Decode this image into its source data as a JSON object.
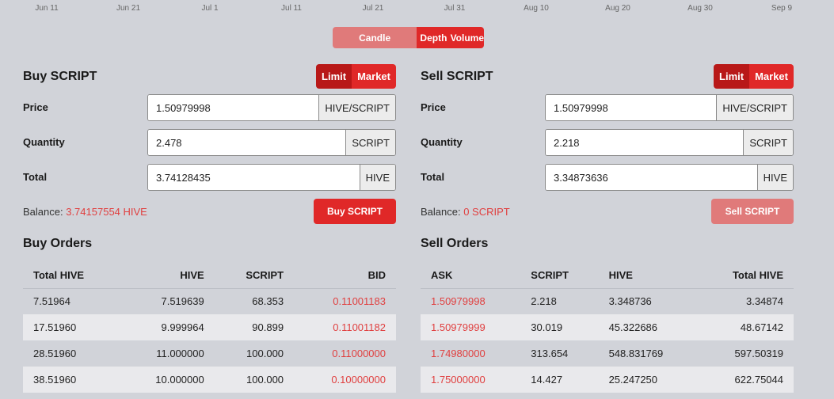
{
  "chart_axis": [
    "Jun 11",
    "Jun 21",
    "Jul 1",
    "Jul 11",
    "Jul 21",
    "Jul 31",
    "Aug 10",
    "Aug 20",
    "Aug 30",
    "Sep 9"
  ],
  "chart_tabs": [
    "Candle",
    "Depth",
    "Volume"
  ],
  "chart_tab_active": "Candle",
  "buy": {
    "title": "Buy SCRIPT",
    "modes": [
      "Limit",
      "Market"
    ],
    "mode_active": "Limit",
    "price_label": "Price",
    "price_value": "1.50979998",
    "price_unit": "HIVE/SCRIPT",
    "quantity_label": "Quantity",
    "quantity_value": "2.478",
    "quantity_unit": "SCRIPT",
    "total_label": "Total",
    "total_value": "3.74128435",
    "total_unit": "HIVE",
    "balance_label": "Balance:",
    "balance_value": "3.74157554 HIVE",
    "button_label": "Buy SCRIPT"
  },
  "sell": {
    "title": "Sell SCRIPT",
    "modes": [
      "Limit",
      "Market"
    ],
    "mode_active": "Limit",
    "price_label": "Price",
    "price_value": "1.50979998",
    "price_unit": "HIVE/SCRIPT",
    "quantity_label": "Quantity",
    "quantity_value": "2.218",
    "quantity_unit": "SCRIPT",
    "total_label": "Total",
    "total_value": "3.34873636",
    "total_unit": "HIVE",
    "balance_label": "Balance:",
    "balance_value": "0 SCRIPT",
    "button_label": "Sell SCRIPT"
  },
  "buy_orders": {
    "title": "Buy Orders",
    "headers": [
      "Total HIVE",
      "HIVE",
      "SCRIPT",
      "BID"
    ],
    "rows": [
      [
        "7.51964",
        "7.519639",
        "68.353",
        "0.11001183"
      ],
      [
        "17.51960",
        "9.999964",
        "90.899",
        "0.11001182"
      ],
      [
        "28.51960",
        "11.000000",
        "100.000",
        "0.11000000"
      ],
      [
        "38.51960",
        "10.000000",
        "100.000",
        "0.10000000"
      ]
    ]
  },
  "sell_orders": {
    "title": "Sell Orders",
    "headers": [
      "ASK",
      "SCRIPT",
      "HIVE",
      "Total HIVE"
    ],
    "rows": [
      [
        "1.50979998",
        "2.218",
        "3.348736",
        "3.34874"
      ],
      [
        "1.50979999",
        "30.019",
        "45.322686",
        "48.67142"
      ],
      [
        "1.74980000",
        "313.654",
        "548.831769",
        "597.50319"
      ],
      [
        "1.75000000",
        "14.427",
        "25.247250",
        "622.75044"
      ]
    ]
  },
  "colors": {
    "accent": "#e02828",
    "accent_active": "#b81818",
    "accent_muted": "#e07a7a",
    "price_red": "#e04040",
    "background": "#d1d3d9"
  }
}
